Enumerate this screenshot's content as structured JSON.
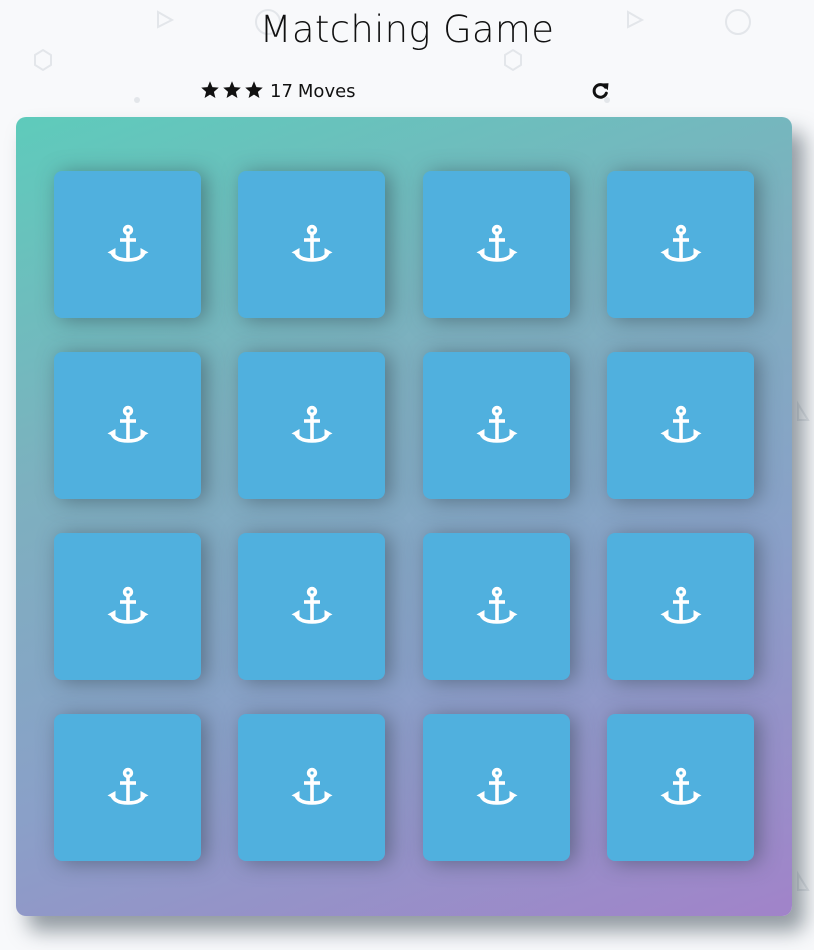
{
  "header": {
    "title": "Matching Game"
  },
  "score_panel": {
    "star_rating": 3,
    "stars": [
      "star-icon",
      "star-icon",
      "star-icon"
    ],
    "moves_count": "17",
    "moves_label": "Moves",
    "restart_icon": "repeat-icon"
  },
  "deck": {
    "rows": 4,
    "columns": 4,
    "cards": [
      {
        "icon": "anchor-icon",
        "state": "open"
      },
      {
        "icon": "anchor-icon",
        "state": "open"
      },
      {
        "icon": "anchor-icon",
        "state": "open"
      },
      {
        "icon": "anchor-icon",
        "state": "open"
      },
      {
        "icon": "anchor-icon",
        "state": "open"
      },
      {
        "icon": "anchor-icon",
        "state": "open"
      },
      {
        "icon": "anchor-icon",
        "state": "open"
      },
      {
        "icon": "anchor-icon",
        "state": "open"
      },
      {
        "icon": "anchor-icon",
        "state": "open"
      },
      {
        "icon": "anchor-icon",
        "state": "open"
      },
      {
        "icon": "anchor-icon",
        "state": "open"
      },
      {
        "icon": "anchor-icon",
        "state": "open"
      },
      {
        "icon": "anchor-icon",
        "state": "open"
      },
      {
        "icon": "anchor-icon",
        "state": "open"
      },
      {
        "icon": "anchor-icon",
        "state": "open"
      },
      {
        "icon": "anchor-icon",
        "state": "open"
      }
    ]
  },
  "colors": {
    "card_open": "#50b0de",
    "deck_gradient_start": "#5ecbbb",
    "deck_gradient_end": "#a183c9",
    "icon": "#ffffff",
    "text": "#111111"
  }
}
